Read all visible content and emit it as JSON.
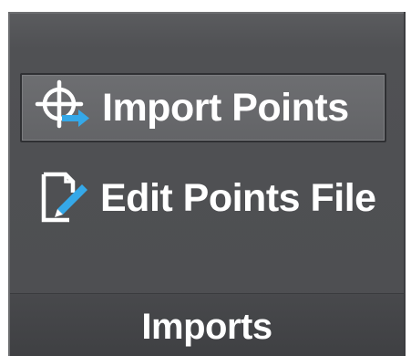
{
  "panel": {
    "title": "Imports",
    "buttons": [
      {
        "label": "Import Points",
        "icon": "import-points-icon",
        "state": "hovered"
      },
      {
        "label": "Edit Points File",
        "icon": "edit-points-file-icon",
        "state": "normal"
      }
    ]
  },
  "colors": {
    "panel_bg": "#505154",
    "footer_bg": "#444548",
    "text": "#ffffff",
    "icon_accent": "#35a8e8"
  }
}
